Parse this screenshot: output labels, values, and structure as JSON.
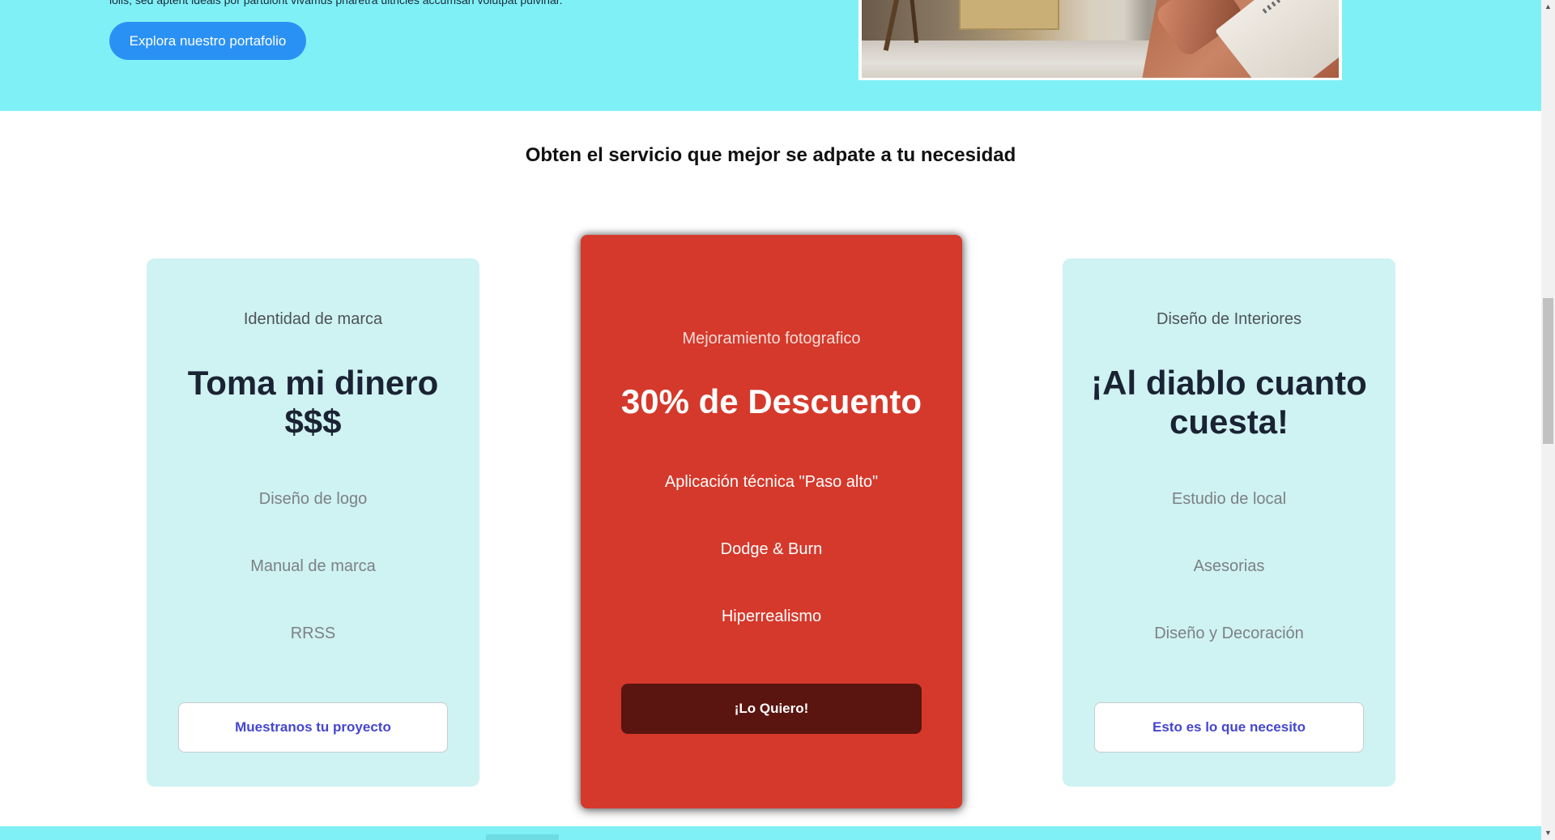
{
  "hero": {
    "text": "iolis, sed aptent ideals por partuiont vivamus pharetra ultricies accumsan volutpat pulvinar.",
    "button_label": "Explora nuestro portafolio"
  },
  "section": {
    "title": "Obten el servicio que mejor se adpate a tu necesidad"
  },
  "cards": [
    {
      "subtitle": "Identidad de marca",
      "headline": "Toma mi dinero $$$",
      "features": [
        "Diseño de logo",
        "Manual de marca",
        "RRSS"
      ],
      "button_label": "Muestranos tu proyecto"
    },
    {
      "subtitle": "Mejoramiento fotografico",
      "headline": "30% de Descuento",
      "features": [
        "Aplicación técnica \"Paso alto\"",
        "Dodge & Burn",
        "Hiperrealismo"
      ],
      "button_label": "¡Lo Quiero!"
    },
    {
      "subtitle": "Diseño de Interiores",
      "headline": "¡Al diablo cuanto cuesta!",
      "features": [
        "Estudio de local",
        "Asesorias",
        "Diseño y Decoración"
      ],
      "button_label": "Esto es lo que necesito"
    }
  ],
  "colors": {
    "hero_background": "#80f0f7",
    "hero_button": "#2a91f4",
    "card_background": "#cff2f2",
    "featured_card": "#d5392b",
    "featured_button": "#5a1510",
    "card_button_text": "#4546cf"
  },
  "icons": {
    "scroll_up": "▲",
    "scroll_down": "▼"
  }
}
